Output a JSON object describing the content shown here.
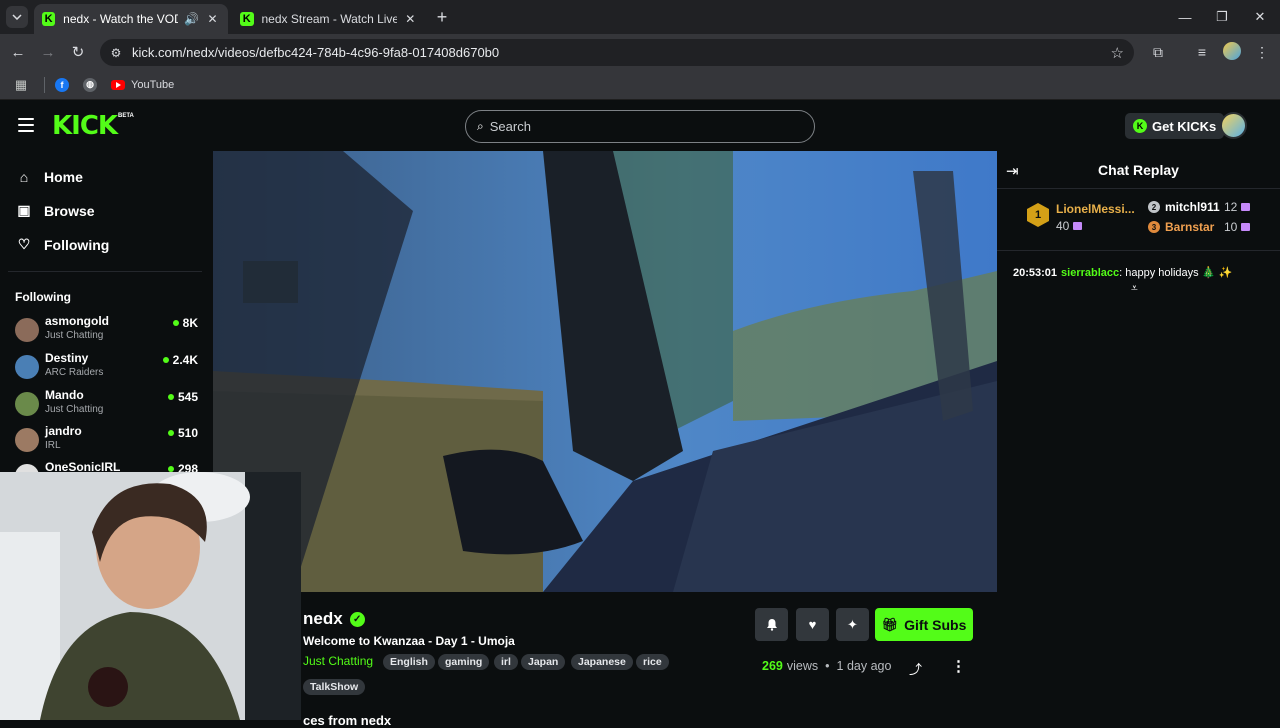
{
  "browser": {
    "tabs": [
      {
        "title": "nedx - Watch the VOD on Kick",
        "favicon": "K"
      },
      {
        "title": "nedx Stream - Watch Live on Kick",
        "favicon": "K"
      }
    ],
    "url": "kick.com/nedx/videos/defbc424-784b-4c96-9fa8-017408d670b0",
    "bookmarks": {
      "youtube_label": "YouTube"
    }
  },
  "kick": {
    "logo": "KICK",
    "logo_badge": "BETA",
    "search_placeholder": "Search",
    "get_kicks_label": "Get KICKs",
    "get_kicks_icon": "K",
    "nav": {
      "home": "Home",
      "browse": "Browse",
      "following": "Following"
    },
    "following_header": "Following",
    "following": [
      {
        "name": "asmongold",
        "category": "Just Chatting",
        "viewers": "8K",
        "color": "#8b6b5a"
      },
      {
        "name": "Destiny",
        "category": "ARC Raiders",
        "viewers": "2.4K",
        "color": "#4a7fb5"
      },
      {
        "name": "Mando",
        "category": "Just Chatting",
        "viewers": "545",
        "color": "#6a8a4a"
      },
      {
        "name": "jandro",
        "category": "IRL",
        "viewers": "510",
        "color": "#9c7a63"
      },
      {
        "name": "OneSonicIRL",
        "category": "",
        "viewers": "298",
        "color": "#e0e0e0"
      }
    ]
  },
  "video": {
    "streamer": "nedx",
    "verified_icon": "✓",
    "title": "Welcome to Kwanzaa - Day 1 - Umoja",
    "category": "Just Chatting",
    "tags": [
      "English",
      "gaming",
      "irl",
      "Japan",
      "Japanese",
      "rice",
      "TalkShow"
    ],
    "views_count": "269",
    "views_label": "views",
    "meta_sep": "•",
    "posted": "1 day ago",
    "gift_label": "Gift Subs",
    "more_from": "ces from nedx"
  },
  "chat": {
    "title": "Chat Replay",
    "leaders": [
      {
        "rank": "1",
        "name": "LionelMessi...",
        "count": "40",
        "color": "#e8b04a"
      },
      {
        "rank": "2",
        "name": "mitchl911",
        "count": "12",
        "color": "#ffffff"
      },
      {
        "rank": "3",
        "name": "Barnstar",
        "count": "10",
        "color": "#f0a050"
      }
    ],
    "messages": [
      {
        "time": "20:53:01",
        "user": "sierrablacc",
        "separator": ":",
        "text": "happy holidays 🎄 ✨"
      }
    ]
  },
  "colors": {
    "accent": "#53fc18",
    "bg": "#0b0e0f",
    "chip": "#32373c"
  }
}
